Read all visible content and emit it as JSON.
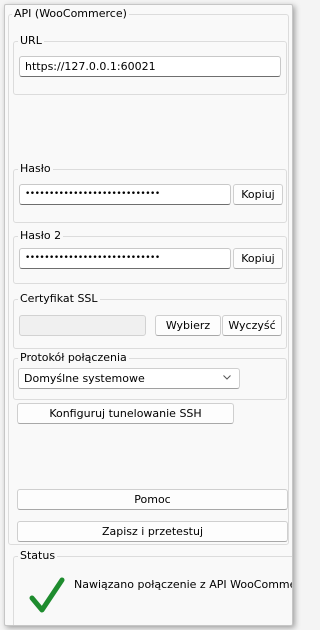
{
  "main_group": {
    "legend": "API (WooCommerce)"
  },
  "url": {
    "legend": "URL",
    "value": "https://127.0.0.1:60021"
  },
  "password": {
    "legend": "Hasło",
    "masked_value": "••••••••••••••••••••••••••••",
    "copy_label": "Kopiuj"
  },
  "password2": {
    "legend": "Hasło 2",
    "masked_value": "••••••••••••••••••••••••••••",
    "copy_label": "Kopiuj"
  },
  "ssl": {
    "legend": "Certyfikat SSL",
    "value": "",
    "choose_label": "Wybierz",
    "clear_label": "Wyczyść"
  },
  "protocol": {
    "legend": "Protokół połączenia",
    "selected": "Domyślne systemowe"
  },
  "ssh_button_label": "Konfiguruj tunelowanie SSH",
  "help_button_label": "Pomoc",
  "save_test_button_label": "Zapisz i przetestuj",
  "status": {
    "legend": "Status",
    "message": "Nawiązano połączenie z API WooCommerce",
    "state_icon": "checkmark-icon",
    "state_color": "#1e8c2e"
  }
}
